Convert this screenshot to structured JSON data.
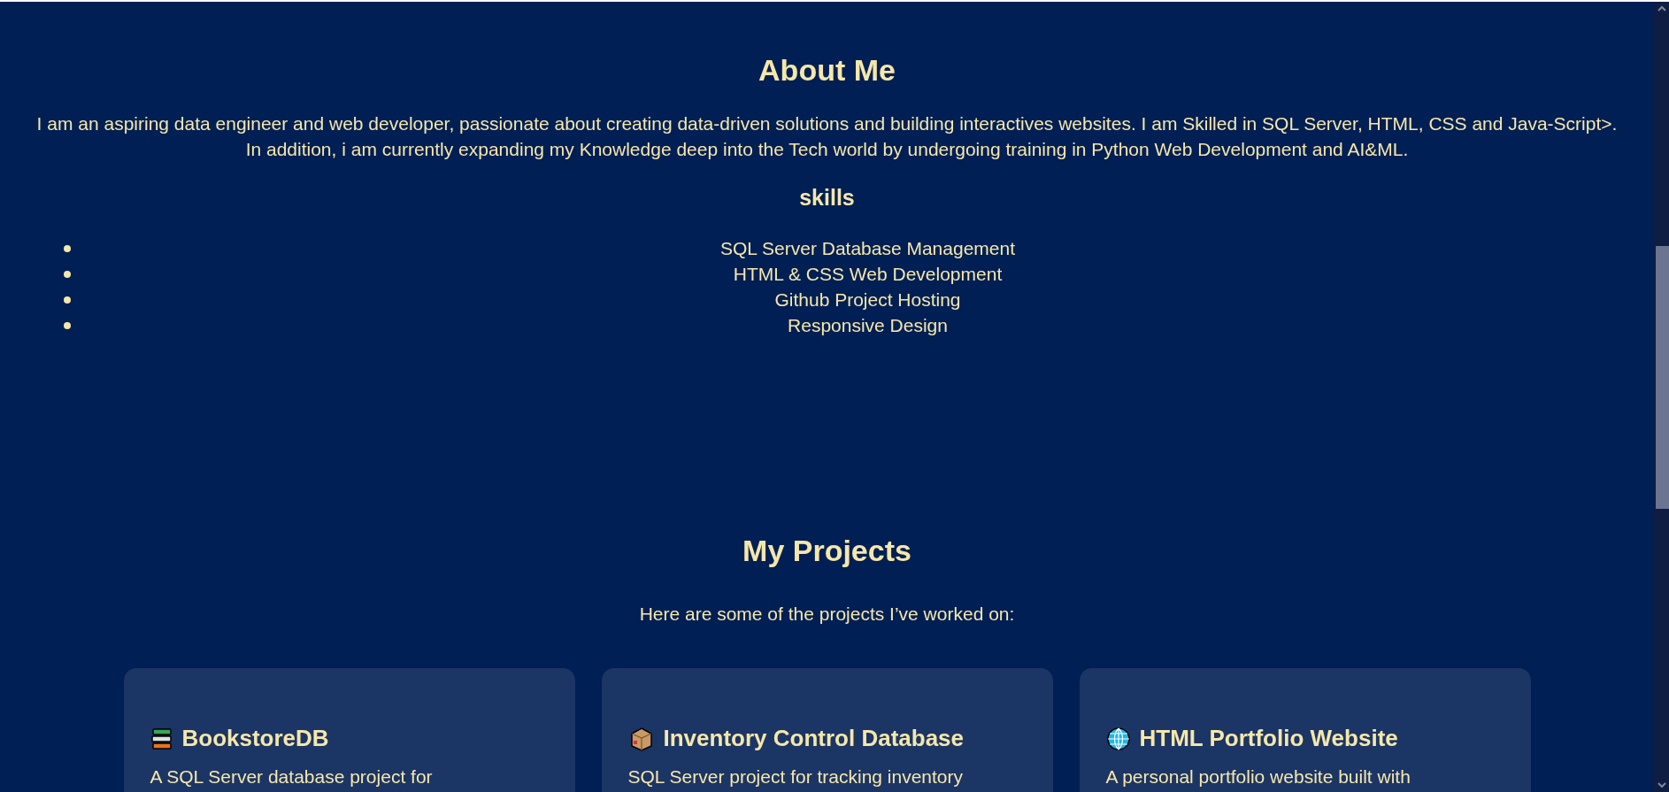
{
  "about": {
    "title": "About Me",
    "text": "I am an aspiring data engineer and web developer, passionate about creating data-driven solutions and building interactives websites. I am Skilled in SQL Server, HTML, CSS and Java-Script>. In addition, i am currently expanding my Knowledge deep into the Tech world by undergoing training in Python Web Development and AI&ML."
  },
  "skills": {
    "title": "skills",
    "items": [
      "SQL Server Database Management",
      "HTML & CSS Web Development",
      "Github Project Hosting",
      "Responsive Design"
    ]
  },
  "projects": {
    "title": "My Projects",
    "subtitle": "Here are some of the projects I’ve worked on:",
    "cards": [
      {
        "kind": "books",
        "title": "BookstoreDB",
        "description": "A SQL Server database project for"
      },
      {
        "kind": "package",
        "title": "Inventory Control Database",
        "description": "SQL Server project for tracking inventory"
      },
      {
        "kind": "globe",
        "title": "HTML Portfolio Website",
        "description": "A personal portfolio website built with"
      }
    ]
  }
}
